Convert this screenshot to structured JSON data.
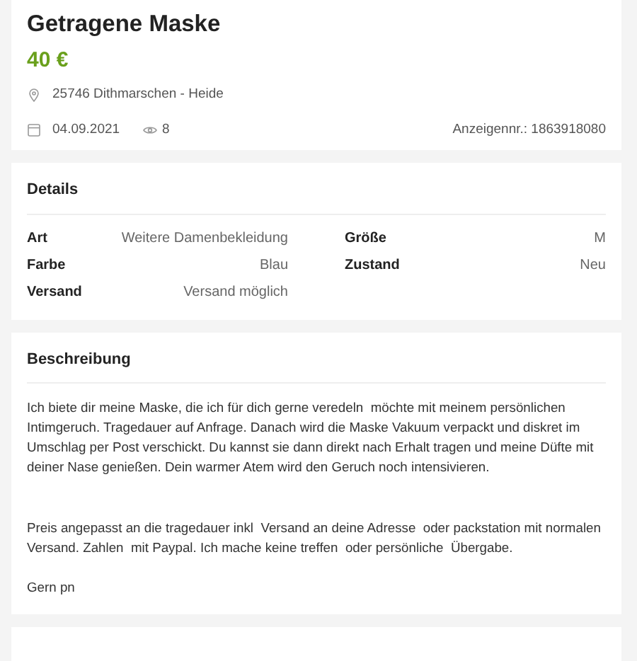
{
  "listing": {
    "title": "Getragene Maske",
    "price": "40 €",
    "location": "25746 Dithmarschen - Heide",
    "date": "04.09.2021",
    "views": "8",
    "ad_number": "Anzeigennr.: 1863918080"
  },
  "details": {
    "heading": "Details",
    "attributes": [
      {
        "label": "Art",
        "value": "Weitere Damenbekleidung"
      },
      {
        "label": "Größe",
        "value": "M"
      },
      {
        "label": "Farbe",
        "value": "Blau"
      },
      {
        "label": "Zustand",
        "value": "Neu"
      },
      {
        "label": "Versand",
        "value": "Versand möglich"
      }
    ]
  },
  "description": {
    "heading": "Beschreibung",
    "text": "Ich biete dir meine Maske, die ich für dich gerne veredeln  möchte mit meinem persönlichen Intimgeruch. Tragedauer auf Anfrage. Danach wird die Maske Vakuum verpackt und diskret im Umschlag per Post verschickt. Du kannst sie dann direkt nach Erhalt tragen und meine Düfte mit deiner Nase genießen. Dein warmer Atem wird den Geruch noch intensivieren.\n\n\nPreis angepasst an die tragedauer inkl  Versand an deine Adresse  oder packstation mit normalen Versand. Zahlen  mit Paypal. Ich mache keine treffen  oder persönliche  Übergabe.\n\nGern pn"
  }
}
